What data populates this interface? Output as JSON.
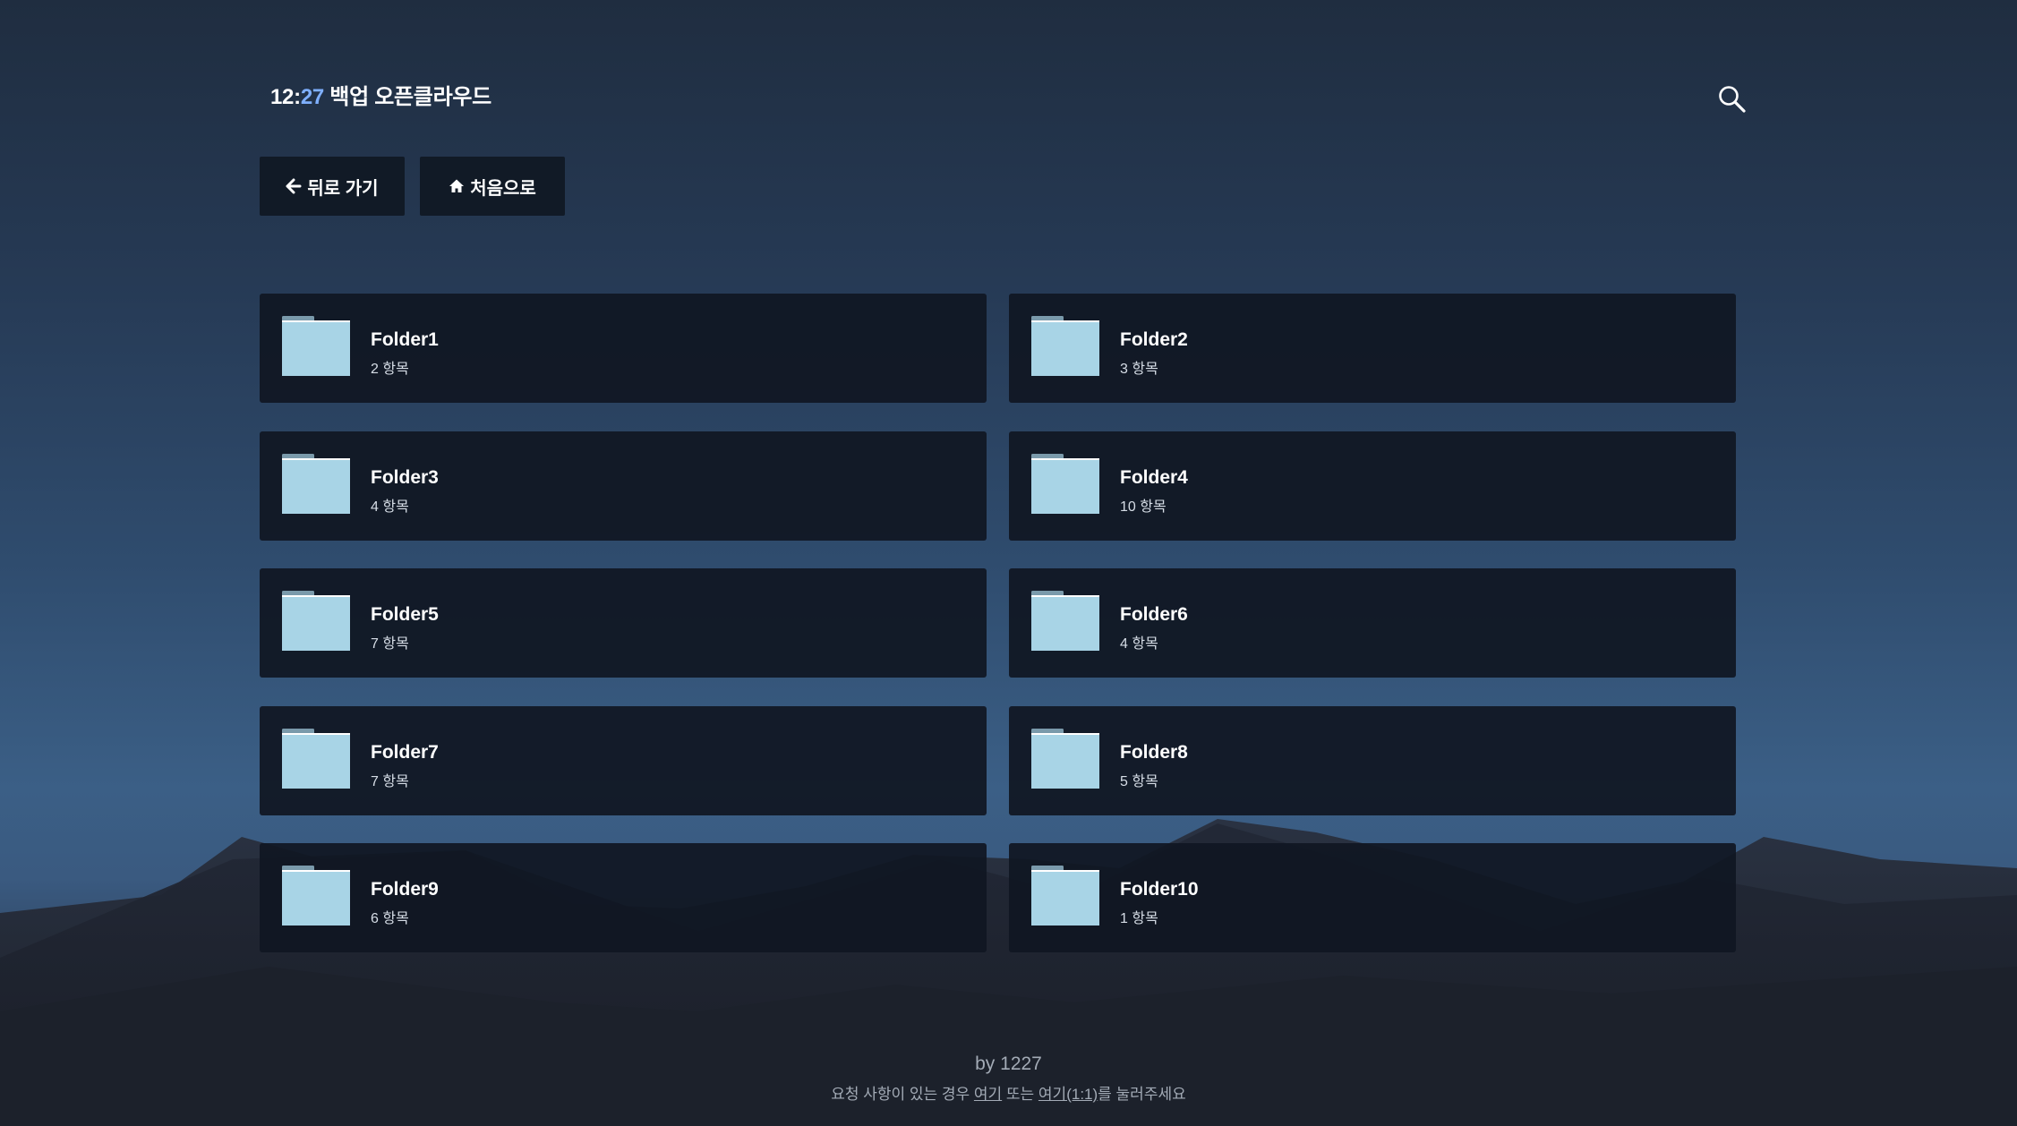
{
  "header": {
    "hours": "12",
    "minutes": "27",
    "title": "백업 오픈클라우드"
  },
  "toolbar": {
    "back_label": "뒤로 가기",
    "home_label": "처음으로"
  },
  "folders": [
    {
      "name": "Folder1",
      "count": "2 항목"
    },
    {
      "name": "Folder2",
      "count": "3 항목"
    },
    {
      "name": "Folder3",
      "count": "4 항목"
    },
    {
      "name": "Folder4",
      "count": "10 항목"
    },
    {
      "name": "Folder5",
      "count": "7 항목"
    },
    {
      "name": "Folder6",
      "count": "4 항목"
    },
    {
      "name": "Folder7",
      "count": "7 항목"
    },
    {
      "name": "Folder8",
      "count": "5 항목"
    },
    {
      "name": "Folder9",
      "count": "6 항목"
    },
    {
      "name": "Folder10",
      "count": "1 항목"
    }
  ],
  "footer": {
    "by": "by 1227",
    "note_prefix": "요청 사항이 있는 경우 ",
    "link1": "여기",
    "note_middle": " 또는 ",
    "link2": "여기(1:1)",
    "note_suffix": "를 눌러주세요"
  },
  "icons": {
    "search": "search-icon",
    "back": "arrow-left-icon",
    "home": "home-icon",
    "folder": "folder-icon"
  },
  "colors": {
    "accent_minutes": "#7fb0ff",
    "card_bg": "#101722",
    "folder": "#a8d4e6"
  }
}
